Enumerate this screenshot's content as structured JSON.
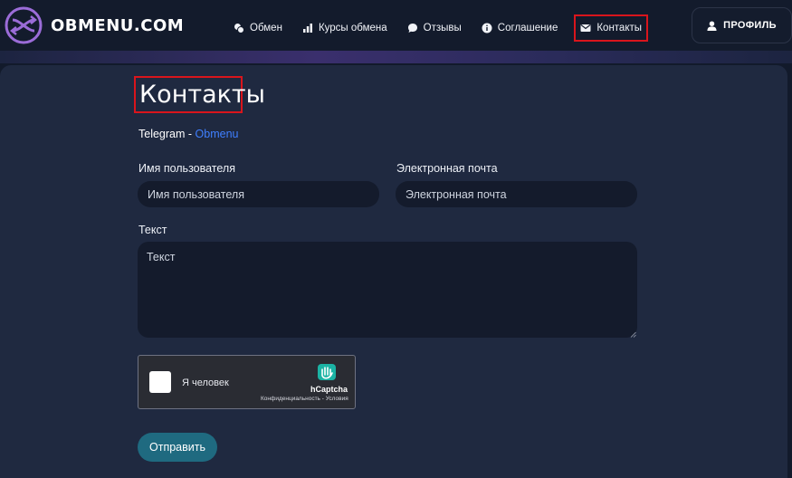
{
  "brand": {
    "name": "OBMENU.COM"
  },
  "nav": {
    "items": [
      {
        "label": "Обмен",
        "icon": "coins-icon"
      },
      {
        "label": "Курсы обмена",
        "icon": "bar-chart-icon"
      },
      {
        "label": "Отзывы",
        "icon": "comment-icon"
      },
      {
        "label": "Соглашение",
        "icon": "info-icon"
      },
      {
        "label": "Контакты",
        "icon": "envelope-icon",
        "active": true
      }
    ]
  },
  "profile": {
    "label": "ПРОФИЛЬ",
    "icon": "user-icon"
  },
  "page": {
    "title": "Контакты",
    "telegram_prefix": "Telegram - ",
    "telegram_link": "Obmenu"
  },
  "form": {
    "username_label": "Имя пользователя",
    "username_placeholder": "Имя пользователя",
    "email_label": "Электронная почта",
    "email_placeholder": "Электронная почта",
    "text_label": "Текст",
    "text_placeholder": "Текст",
    "submit_label": "Отправить"
  },
  "captcha": {
    "label": "Я человек",
    "provider": "hCaptcha",
    "links": "Конфиденциальность - Условия"
  },
  "colors": {
    "highlight": "#d9151c",
    "link": "#3f7fff",
    "button": "#1f6a80"
  }
}
